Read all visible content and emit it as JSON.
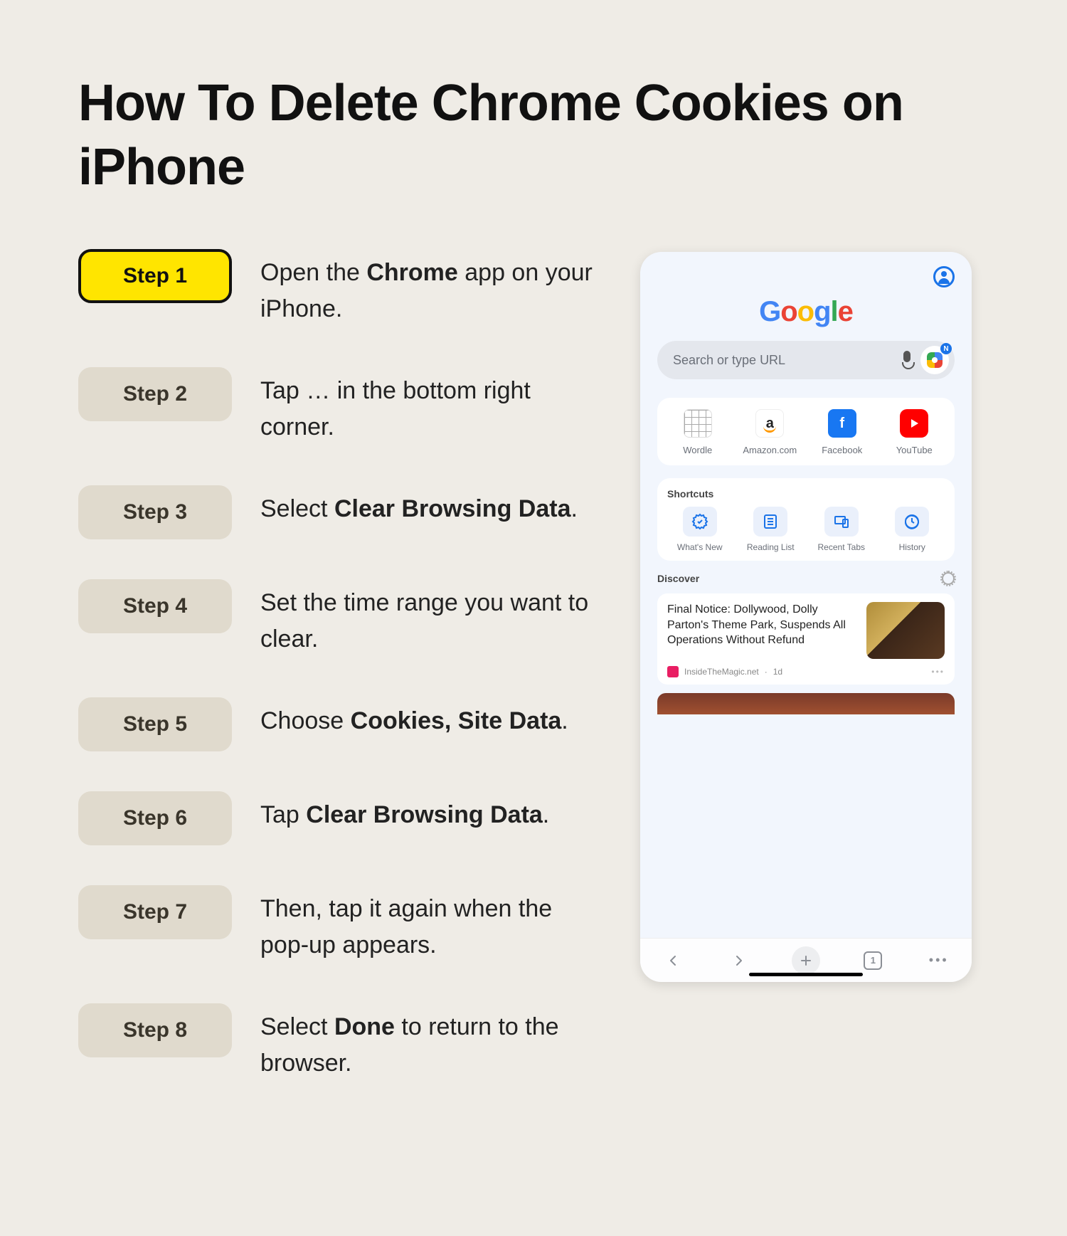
{
  "title": "How To Delete Chrome Cookies on iPhone",
  "steps": [
    {
      "label": "Step 1",
      "text_pre": "Open the ",
      "bold": "Chrome",
      "text_post": " app on your iPhone.",
      "active": true
    },
    {
      "label": "Step 2",
      "text_pre": "Tap … in the bottom right corner.",
      "bold": "",
      "text_post": ""
    },
    {
      "label": "Step 3",
      "text_pre": "Select ",
      "bold": "Clear Browsing Data",
      "text_post": "."
    },
    {
      "label": "Step 4",
      "text_pre": "Set the time range you want to clear.",
      "bold": "",
      "text_post": ""
    },
    {
      "label": "Step 5",
      "text_pre": "Choose ",
      "bold": "Cookies, Site Data",
      "text_post": "."
    },
    {
      "label": "Step 6",
      "text_pre": "Tap ",
      "bold": "Clear Browsing Data",
      "text_post": "."
    },
    {
      "label": "Step 7",
      "text_pre": "Then, tap it again when the pop-up appears.",
      "bold": "",
      "text_post": ""
    },
    {
      "label": "Step 8",
      "text_pre": "Select ",
      "bold": "Done",
      "text_post": " to return to the browser."
    }
  ],
  "phone": {
    "search_placeholder": "Search or type URL",
    "quick": [
      {
        "label": "Wordle"
      },
      {
        "label": "Amazon.com"
      },
      {
        "label": "Facebook"
      },
      {
        "label": "YouTube"
      }
    ],
    "shortcuts_title": "Shortcuts",
    "shortcuts": [
      {
        "label": "What's New"
      },
      {
        "label": "Reading List"
      },
      {
        "label": "Recent Tabs"
      },
      {
        "label": "History"
      }
    ],
    "discover_label": "Discover",
    "article": {
      "headline": "Final Notice: Dollywood, Dolly Parton's Theme Park, Suspends All Operations Without Refund",
      "source": "InsideTheMagic.net",
      "age": "1d"
    },
    "tab_count": "1"
  }
}
